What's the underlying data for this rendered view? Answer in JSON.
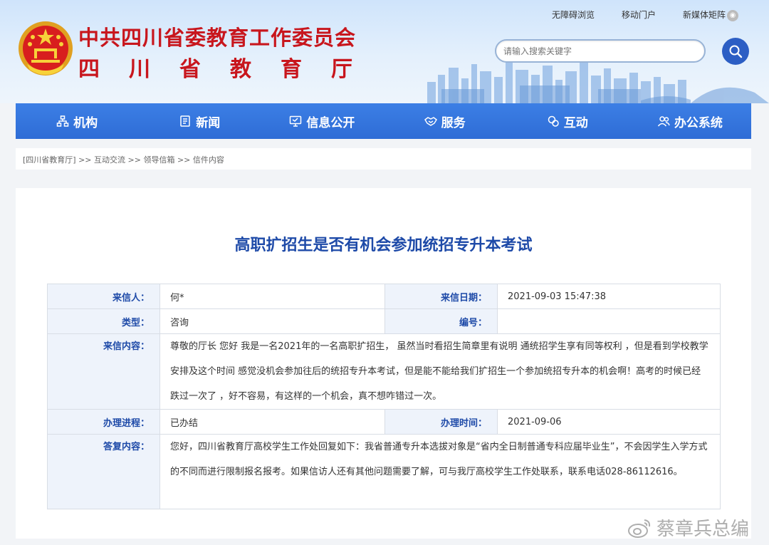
{
  "header": {
    "org_title": "中共四川省委教育工作委员会",
    "dept_chars": [
      "四",
      "川",
      "省",
      "教",
      "育",
      "厅"
    ],
    "top_links": [
      "无障碍浏览",
      "移动门户",
      "新媒体矩阵"
    ],
    "search_placeholder": "请输入搜索关键字"
  },
  "nav": [
    {
      "label": "机构",
      "icon": "org-chart-icon"
    },
    {
      "label": "新闻",
      "icon": "news-icon"
    },
    {
      "label": "信息公开",
      "icon": "monitor-icon"
    },
    {
      "label": "服务",
      "icon": "handshake-icon"
    },
    {
      "label": "互动",
      "icon": "chat-icon"
    },
    {
      "label": "办公系统",
      "icon": "users-icon"
    }
  ],
  "breadcrumb": [
    "[四川省教育厅]",
    ">>",
    "互动交流",
    ">>",
    "领导信箱",
    ">>",
    "信件内容"
  ],
  "letter": {
    "title": "高职扩招生是否有机会参加统招专升本考试",
    "sender_label": "来信人：",
    "sender": "何*",
    "date_label": "来信日期：",
    "date": "2021-09-03 15:47:38",
    "type_label": "类型：",
    "type": "咨询",
    "number_label": "编号：",
    "number": "",
    "content_label": "来信内容：",
    "content": "尊敬的厅长 您好 我是一名2021年的一名高职扩招生， 虽然当时看招生简章里有说明 通统招学生享有同等权利 ，但是看到学校教学安排及这个时间 感觉没机会参加往后的统招专升本考试，但是能不能给我们扩招生一个参加统招专升本的机会啊！高考的时候已经跌过一次了 ，好不容易，有这样的一个机会，真不想咋错过一次。",
    "progress_label": "办理进程：",
    "progress": "已办结",
    "handle_time_label": "办理时间：",
    "handle_time": "2021-09-06",
    "reply_label": "答复内容：",
    "reply": "您好，四川省教育厅高校学生工作处回复如下：我省普通专升本选拔对象是“省内全日制普通专科应届毕业生”，不会因学生入学方式的不同而进行限制报名报考。如果信访人还有其他问题需要了解，可与我厅高校学生工作处联系，联系电话028-86112616。"
  },
  "watermark": "蔡章兵总编",
  "colors": {
    "brand_red": "#c8161d",
    "nav_blue": "#2e6cd6",
    "title_blue": "#1e4aa8",
    "label_bg": "#eef3fb"
  }
}
